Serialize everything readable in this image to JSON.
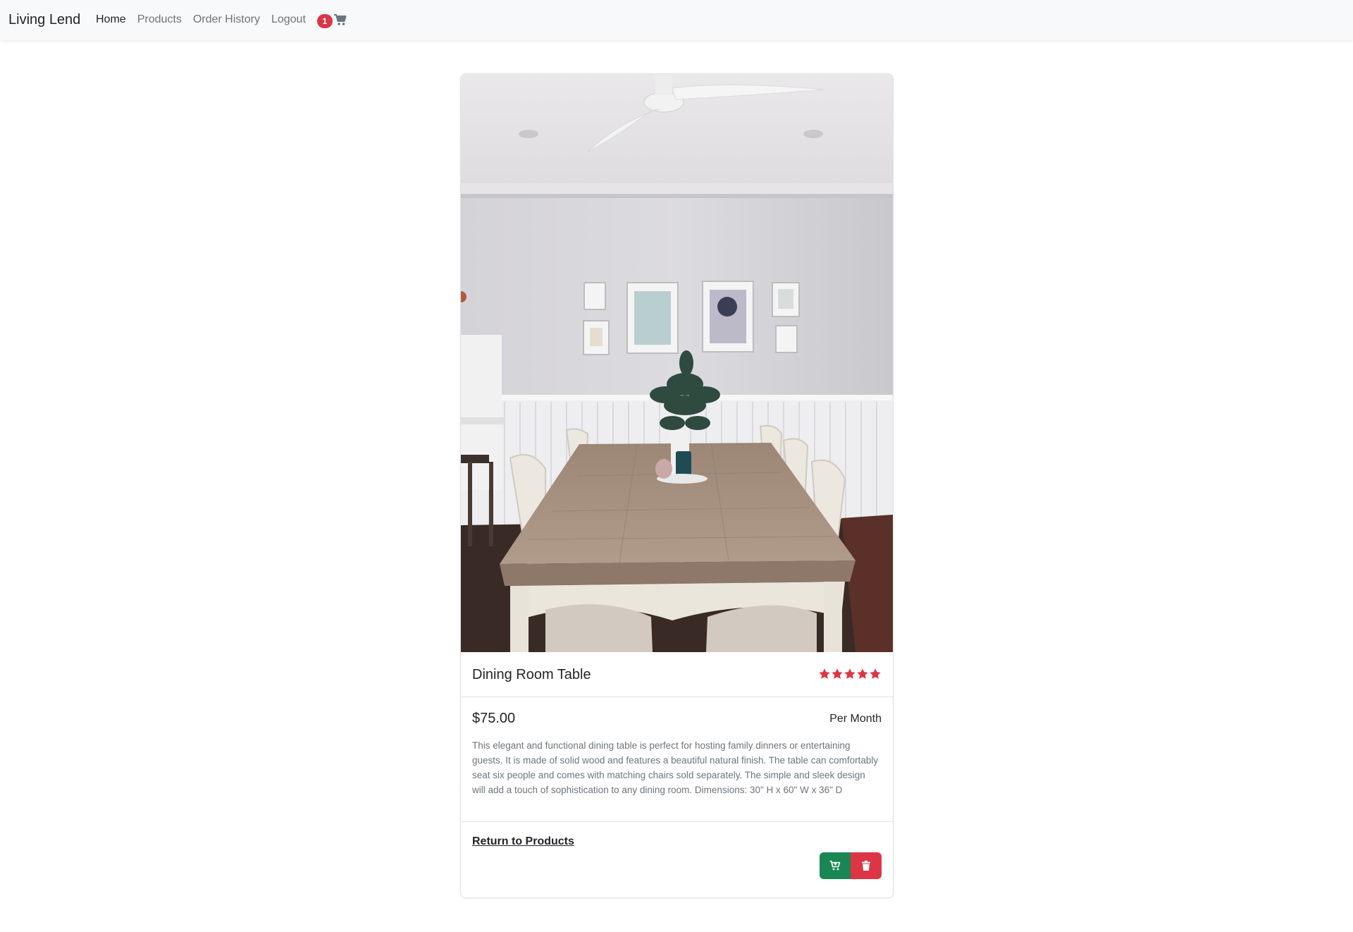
{
  "navbar": {
    "brand": "Living Lend",
    "links": [
      {
        "label": "Home",
        "active": true
      },
      {
        "label": "Products",
        "active": false
      },
      {
        "label": "Order History",
        "active": false
      },
      {
        "label": "Logout",
        "active": false
      }
    ],
    "cart_count": "1",
    "cart_icon": "cart-icon"
  },
  "product": {
    "name": "Dining Room Table",
    "rating": 5,
    "rating_max": 5,
    "price": "$75.00",
    "period": "Per Month",
    "description": "This elegant and functional dining table is perfect for hosting family dinners or entertaining guests. It is made of solid wood and features a beautiful natural finish. The table can comfortably seat six people and comes with matching chairs sold separately. The simple and sleek design will add a touch of sophistication to any dining room. Dimensions: 30\" H x 60\" W x 36\" D",
    "return_label": "Return to Products",
    "add_to_cart_icon": "cart-plus-icon",
    "delete_icon": "trash-icon"
  },
  "colors": {
    "navbar_bg": "#f8f9fa",
    "badge": "#dc3545",
    "star": "#dc3545",
    "add_button": "#198754",
    "delete_button": "#dc3545",
    "muted_text": "#6c757d"
  }
}
